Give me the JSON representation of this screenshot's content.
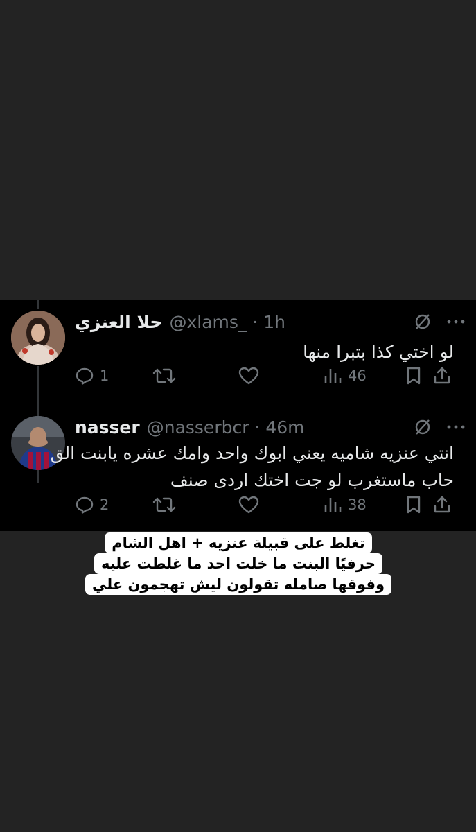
{
  "tweets": [
    {
      "name": "حلا العنزي",
      "handle": "@xlams_ · 1h",
      "text": "لو اختي كذا بتبرا منها",
      "replies": "1",
      "retweets": "",
      "likes": "",
      "views": "46"
    },
    {
      "name": "nasser",
      "handle": "@nasserbcr · 46m",
      "text_line1": "انتي عنزيه شاميه يعني ابوك واحد وامك عشره يابنت الق",
      "text_line2": "حاب ماستغرب لو جت اختك اردى صنف",
      "replies": "2",
      "retweets": "",
      "likes": "",
      "views": "38"
    }
  ],
  "caption": {
    "line1": "تغلط على قبيلة عنزيه + اهل الشام",
    "line2": "حرفيًا البنت ما خلت احد ما غلطت عليه",
    "line3": "وفوقها صامله تقولون ليش تهجمون علي"
  },
  "colors": {
    "page_bg": "#232323",
    "card_bg": "#000000",
    "text": "#e7e9ea",
    "muted": "#71767b"
  }
}
